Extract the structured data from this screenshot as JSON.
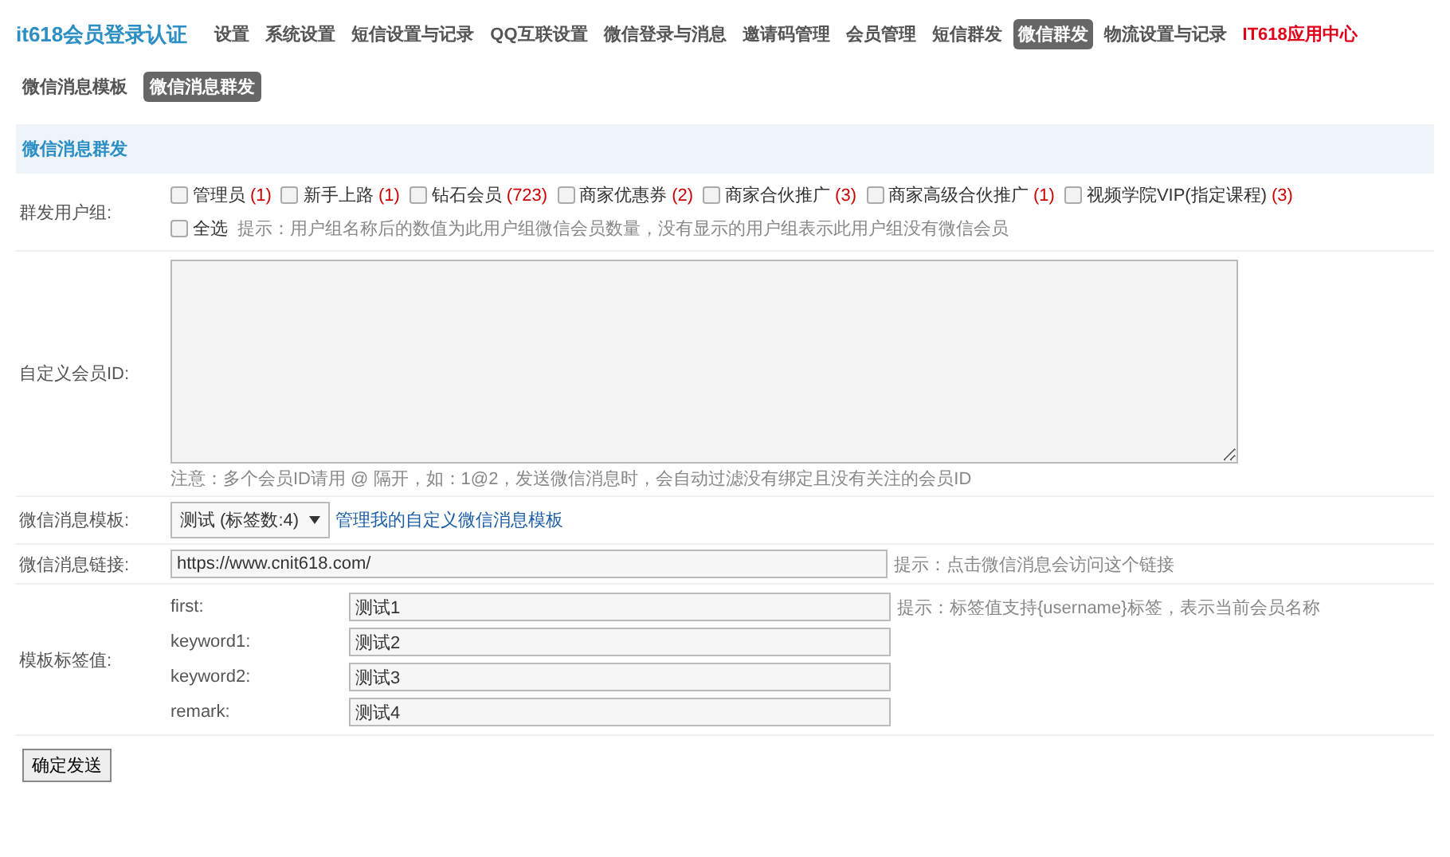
{
  "app_title": "it618会员登录认证",
  "nav": [
    {
      "label": "设置",
      "selected": false,
      "kind": "normal"
    },
    {
      "label": "系统设置",
      "selected": false,
      "kind": "normal"
    },
    {
      "label": "短信设置与记录",
      "selected": false,
      "kind": "normal"
    },
    {
      "label": "QQ互联设置",
      "selected": false,
      "kind": "normal"
    },
    {
      "label": "微信登录与消息",
      "selected": false,
      "kind": "normal"
    },
    {
      "label": "邀请码管理",
      "selected": false,
      "kind": "normal"
    },
    {
      "label": "会员管理",
      "selected": false,
      "kind": "normal"
    },
    {
      "label": "短信群发",
      "selected": false,
      "kind": "normal"
    },
    {
      "label": "微信群发",
      "selected": true,
      "kind": "normal"
    },
    {
      "label": "物流设置与记录",
      "selected": false,
      "kind": "normal"
    },
    {
      "label": "IT618应用中心",
      "selected": false,
      "kind": "highlight"
    }
  ],
  "subtabs": [
    {
      "label": "微信消息模板",
      "selected": false
    },
    {
      "label": "微信消息群发",
      "selected": true
    }
  ],
  "section_title": "微信消息群发",
  "groups_label": "群发用户组:",
  "groups": [
    {
      "name": "管理员",
      "count": "(1)",
      "checked": false
    },
    {
      "name": "新手上路",
      "count": "(1)",
      "checked": false
    },
    {
      "name": "钻石会员",
      "count": "(723)",
      "checked": false
    },
    {
      "name": "商家优惠券",
      "count": "(2)",
      "checked": false
    },
    {
      "name": "商家合伙推广",
      "count": "(3)",
      "checked": false
    },
    {
      "name": "商家高级合伙推广",
      "count": "(1)",
      "checked": false
    },
    {
      "name": "视频学院VIP(指定课程)",
      "count": "(3)",
      "checked": false
    }
  ],
  "select_all": {
    "label": "全选",
    "checked": false
  },
  "groups_hint": "提示：用户组名称后的数值为此用户组微信会员数量，没有显示的用户组表示此用户组没有微信会员",
  "ids_label": "自定义会员ID:",
  "ids_note": "注意：多个会员ID请用 @ 隔开，如：1@2，发送微信消息时，会自动过滤没有绑定且没有关注的会员ID",
  "template_label": "微信消息模板:",
  "template_select": "测试 (标签数:4)",
  "template_link": "管理我的自定义微信消息模板",
  "link_label": "微信消息链接:",
  "link_value": "https://www.cnit618.com/",
  "link_hint": "提示：点击微信消息会访问这个链接",
  "tags_label": "模板标签值:",
  "tags": [
    {
      "name": "first:",
      "value": "测试1",
      "hint": "提示：标签值支持{username}标签，表示当前会员名称"
    },
    {
      "name": "keyword1:",
      "value": "测试2"
    },
    {
      "name": "keyword2:",
      "value": "测试3"
    },
    {
      "name": "remark:",
      "value": "测试4"
    }
  ],
  "submit": "确定发送"
}
